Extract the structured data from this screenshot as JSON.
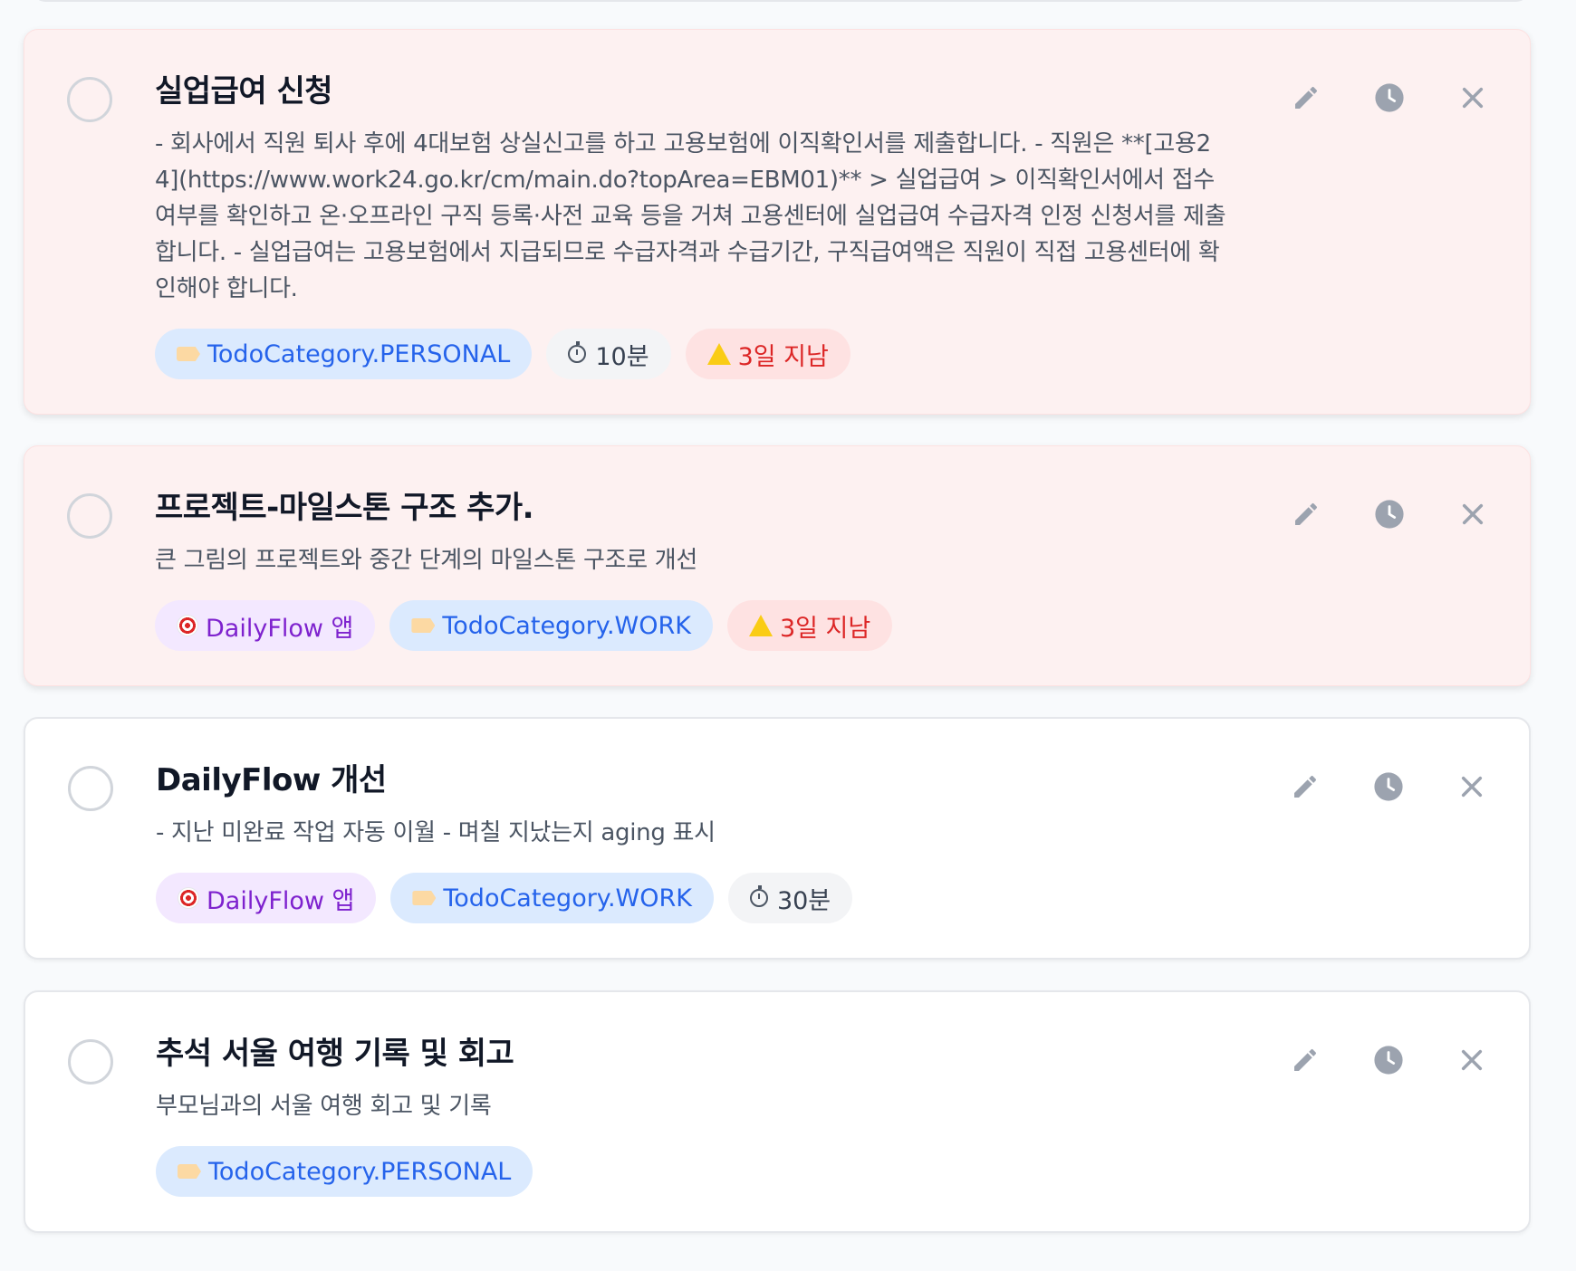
{
  "todos": [
    {
      "title": "실업급여 신청",
      "description": "- 회사에서 직원 퇴사 후에 4대보험 상실신고를 하고 고용보험에 이직확인서를 제출합니다. - 직원은 **[고용24](https://www.work24.go.kr/cm/main.do?topArea=EBM01)** > 실업급여 > 이직확인서에서 접수여부를 확인하고 온·오프라인 구직 등록·사전 교육 등을 거쳐 고용센터에 실업급여 수급자격 인정 신청서를 제출합니다. - 실업급여는 고용보험에서 지급되므로 수급자격과 수급기간, 구직급여액은 직원이 직접 고용센터에 확인해야 합니다.",
      "category": "TodoCategory.PERSONAL",
      "duration": "10분",
      "overdue": "3일 지남"
    },
    {
      "title": "프로젝트-마일스톤 구조 추가.",
      "description": "큰 그림의 프로젝트와 중간 단계의 마일스톤 구조로 개선",
      "project": "DailyFlow 앱",
      "category": "TodoCategory.WORK",
      "overdue": "3일 지남"
    },
    {
      "title": "DailyFlow 개선",
      "description": "- 지난 미완료 작업 자동 이월 - 며칠 지났는지 aging 표시",
      "project": "DailyFlow 앱",
      "category": "TodoCategory.WORK",
      "duration": "30분"
    },
    {
      "title": "추석 서울 여행 기록 및 회고",
      "description": "부모님과의 서울 여행 회고 및 기록",
      "category": "TodoCategory.PERSONAL"
    }
  ],
  "icons": {
    "edit": "pencil-icon",
    "snooze": "clock-icon",
    "delete": "close-icon",
    "category": "label-tag-icon",
    "project": "target-icon",
    "duration": "timer-icon",
    "overdue": "warning-icon"
  },
  "colors": {
    "overdue_bg": "#fdf1f1",
    "category_bg": "#dbeafe",
    "category_text": "#2563eb",
    "project_bg": "#f3e8ff",
    "project_text": "#7e22ce",
    "overdue_text": "#dc2626",
    "icon_gray": "#9ca3af"
  }
}
